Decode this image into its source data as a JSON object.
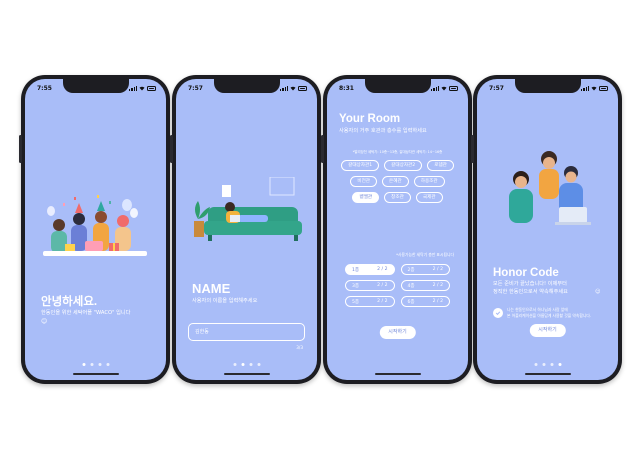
{
  "colors": {
    "screen_bg": "#a9bdf8",
    "frame": "#1d1d22",
    "accent_text": "#6f86d9"
  },
  "screens": [
    {
      "time": "7:55",
      "title": "안녕하세요.",
      "subtitle": "한동인을 위한 세탁어플 \"WACO\" 입니다",
      "emoji": "😊",
      "page_index": 1
    },
    {
      "time": "7:57",
      "title": "NAME",
      "subtitle": "사용자의 이름을 입력해주세요",
      "input_value": "김한동",
      "counter": "3/3",
      "page_index": 2
    },
    {
      "time": "8:31",
      "title": "Your Room",
      "subtitle": "사용자의 거주 호관과 층수를 입력하세요",
      "hint_top": "*알리당천 세탁기: 10층~13층, 갈대상자관 세탁기: 14~16층",
      "buildings": [
        "갈대상자관1",
        "갈대상자관2",
        "로뎀관",
        "비전관",
        "은혜관",
        "하용조관",
        "벧엘관",
        "창조관",
        "국제관"
      ],
      "selected_building": "벧엘관",
      "hint_floor": "*사용가능한 세탁기 층만 표시됩니다",
      "floors": [
        {
          "floor": "1층",
          "count": "2 / 2"
        },
        {
          "floor": "2층",
          "count": "2 / 2"
        },
        {
          "floor": "3층",
          "count": "2 / 2"
        },
        {
          "floor": "4층",
          "count": "2 / 2"
        },
        {
          "floor": "5층",
          "count": "2 / 2"
        },
        {
          "floor": "6층",
          "count": "2 / 2"
        }
      ],
      "selected_floor": "1층",
      "button_label": "시작하기"
    },
    {
      "time": "7:57",
      "title": "Honor Code",
      "subtitle_line1": "모든 준비가 끝났습니다! 이제부터",
      "subtitle_line2": "정직한 한동인으로서 약속해주세요",
      "emoji": "😊",
      "agree_line1": "나는 한동인으로서 하나님과 사람 앞에",
      "agree_line2": "본 어플리케이션을 아름답게 사용할 것을 약속합니다.",
      "button_label": "시작하기",
      "page_index": 4
    }
  ]
}
